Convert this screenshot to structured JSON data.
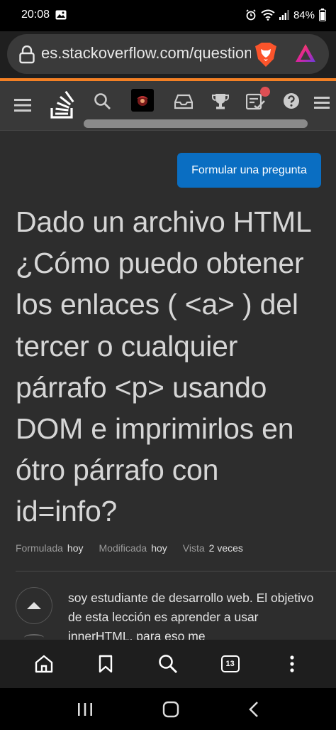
{
  "status_bar": {
    "time": "20:08",
    "battery": "84%",
    "icons": [
      "image-icon",
      "alarm-icon",
      "wifi-icon",
      "signal-icon",
      "battery-icon"
    ]
  },
  "browser": {
    "url": "es.stackoverflow.com/questions",
    "icons": [
      "lock-icon",
      "brave-lion-icon",
      "brave-rewards-icon"
    ]
  },
  "so_header": {
    "icons": [
      "menu-icon",
      "stackoverflow-logo-icon",
      "search-icon",
      "avatar",
      "inbox-icon",
      "achievements-icon",
      "review-icon",
      "help-icon"
    ],
    "accent_color": "#f48024",
    "review_badge_color": "#de4f54"
  },
  "ask_button_label": "Formular una pregunta",
  "question": {
    "title": "Dado un archivo HTML ¿Cómo puedo obtener los enlaces ( <a> ) del tercer o cualquier párrafo <p> usando DOM e imprimirlos en ótro párrafo con id=info?",
    "meta": {
      "asked_label": "Formulada",
      "asked_value": "hoy",
      "modified_label": "Modificada",
      "modified_value": "hoy",
      "viewed_label": "Vista",
      "viewed_value": "2 veces"
    },
    "body": "soy estudiante de desarrollo web. El objetivo de esta lección es aprender a usar innerHTML, para eso me"
  },
  "bottom_nav": {
    "tab_count": "13",
    "icons": [
      "home-icon",
      "bookmark-icon",
      "search-icon",
      "tabs-icon",
      "more-icon"
    ]
  },
  "android_nav": {
    "icons": [
      "recents-icon",
      "home-circle-icon",
      "back-icon"
    ]
  }
}
